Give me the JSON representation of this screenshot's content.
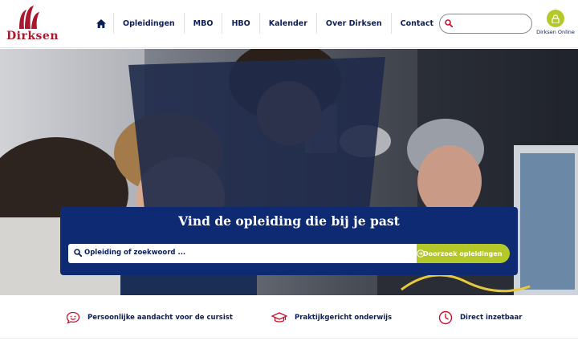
{
  "brand": {
    "logo_text": "Dirksen",
    "brand_color": "#a6192e"
  },
  "nav": {
    "home_icon": "home-icon",
    "items": [
      {
        "label": "Opleidingen"
      },
      {
        "label": "MBO"
      },
      {
        "label": "HBO"
      },
      {
        "label": "Kalender"
      },
      {
        "label": "Over Dirksen"
      },
      {
        "label": "Contact"
      }
    ]
  },
  "header_search": {
    "placeholder": "",
    "icon": "search-icon"
  },
  "online": {
    "label": "Dirksen Online",
    "icon": "lock-icon"
  },
  "hero": {
    "title": "Vind de opleiding die bij je past",
    "search_placeholder": "Opleiding of zoekwoord ...",
    "search_button": "Doorzoek opleidingen"
  },
  "usps": [
    {
      "label": "Persoonlijke aandacht voor de cursist",
      "icon": "chat-smile-icon"
    },
    {
      "label": "Praktijkgericht onderwijs",
      "icon": "graduation-cap-icon"
    },
    {
      "label": "Direct inzetbaar",
      "icon": "clock-icon"
    }
  ],
  "colors": {
    "navy": "#0d2a72",
    "accent_green": "#b5c82a",
    "text_navy": "#0b1e57",
    "icon_red": "#c8102e"
  }
}
